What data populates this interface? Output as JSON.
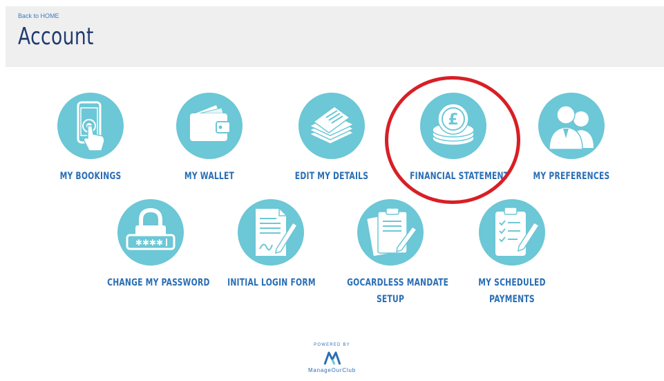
{
  "header": {
    "back_link": "Back to HOME",
    "title": "Account"
  },
  "tiles_row1": [
    {
      "label": "MY BOOKINGS",
      "icon": "phone-tap-icon"
    },
    {
      "label": "MY WALLET",
      "icon": "wallet-icon"
    },
    {
      "label": "EDIT MY DETAILS",
      "icon": "documents-stack-icon"
    },
    {
      "label": "FINANCIAL STATEMENT",
      "icon": "pound-coins-icon"
    },
    {
      "label": "MY PREFERENCES",
      "icon": "people-icon"
    }
  ],
  "tiles_row2": [
    {
      "label": "CHANGE MY PASSWORD",
      "icon": "padlock-password-icon"
    },
    {
      "label": "INITIAL LOGIN FORM",
      "icon": "form-signature-icon"
    },
    {
      "label": "GOCARDLESS MANDATE SETUP",
      "label_line1": "GOCARDLESS MANDATE",
      "label_line2": "SETUP",
      "icon": "clipboard-pen-icon"
    },
    {
      "label": "MY SCHEDULED PAYMENTS",
      "label_line1": "MY SCHEDULED",
      "label_line2": "PAYMENTS",
      "icon": "checklist-clipboard-icon"
    }
  ],
  "footer": {
    "powered_by": "POWERED BY",
    "brand": "ManageOurClub"
  },
  "colors": {
    "icon_circle": "#6cc7d6",
    "label_blue": "#2a6eb5",
    "title_navy": "#1f3b6e",
    "highlight_red": "#d81f26",
    "header_bg": "#efefef"
  }
}
